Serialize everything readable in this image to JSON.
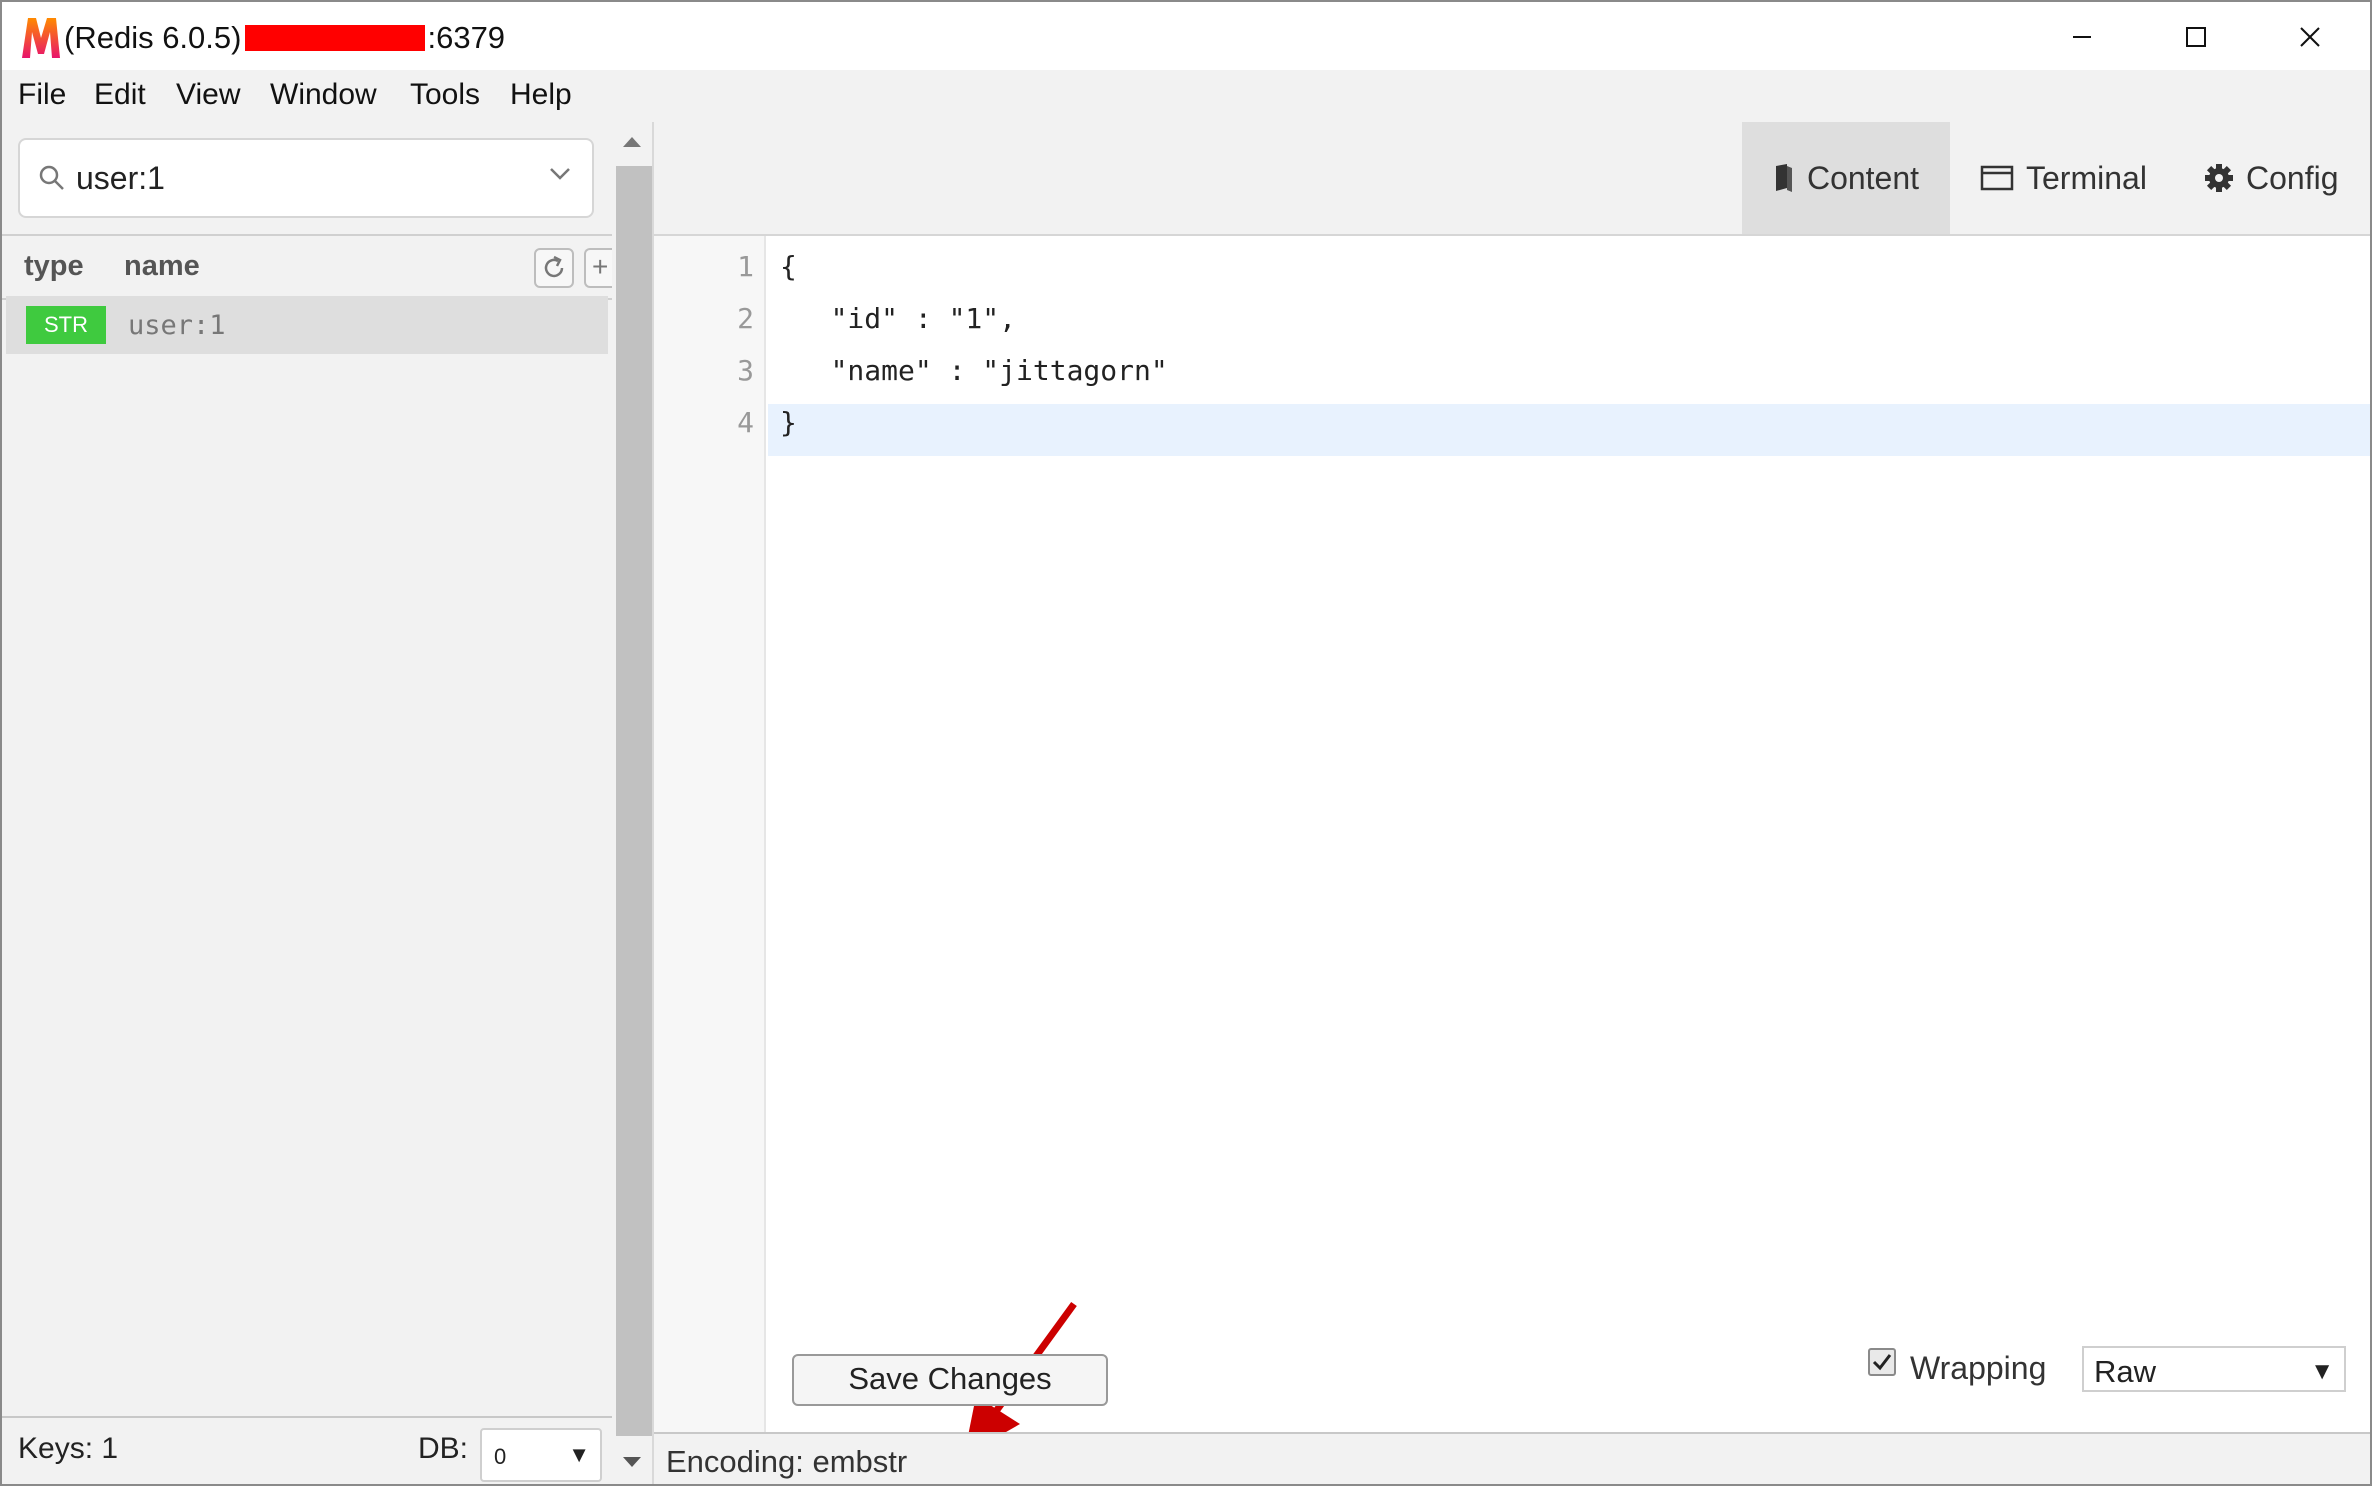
{
  "window": {
    "title_prefix": "(Redis 6.0.5)",
    "title_suffix": ":6379",
    "logo_letter": "M"
  },
  "menu": [
    "File",
    "Edit",
    "View",
    "Window",
    "Tools",
    "Help"
  ],
  "search": {
    "value": "user:1"
  },
  "key_list": {
    "columns": {
      "type": "type",
      "name": "name"
    },
    "add_symbol": "+",
    "rows": [
      {
        "type": "STR",
        "name": "user:1"
      }
    ],
    "badge_color": "#3fca3f"
  },
  "footer_left": {
    "keys": "Keys: 1",
    "db_label": "DB:",
    "db_value": "0",
    "dropdown_arrow": "▼"
  },
  "tabs": [
    {
      "label": "Content",
      "icon": "book-icon",
      "active": true
    },
    {
      "label": "Terminal",
      "icon": "terminal-window-icon"
    },
    {
      "label": "Config",
      "icon": "gear-icon"
    }
  ],
  "editor": {
    "lines": [
      {
        "no": "1",
        "text": "{"
      },
      {
        "no": "2",
        "text": "   \"id\" : \"1\","
      },
      {
        "no": "3",
        "text": "   \"name\" : \"jittagorn\""
      },
      {
        "no": "4",
        "text": "}"
      }
    ],
    "active_line": 4
  },
  "actions": {
    "save": "Save Changes"
  },
  "options": {
    "wrapping_label": "Wrapping",
    "wrapping_checked": true,
    "format": "Raw",
    "dropdown_arrow": "▼"
  },
  "status": {
    "encoding": "Encoding: embstr"
  },
  "colors": {
    "accent_arrow": "#cc0000",
    "redaction": "#ff0000",
    "active_line": "#e8f2fe"
  }
}
